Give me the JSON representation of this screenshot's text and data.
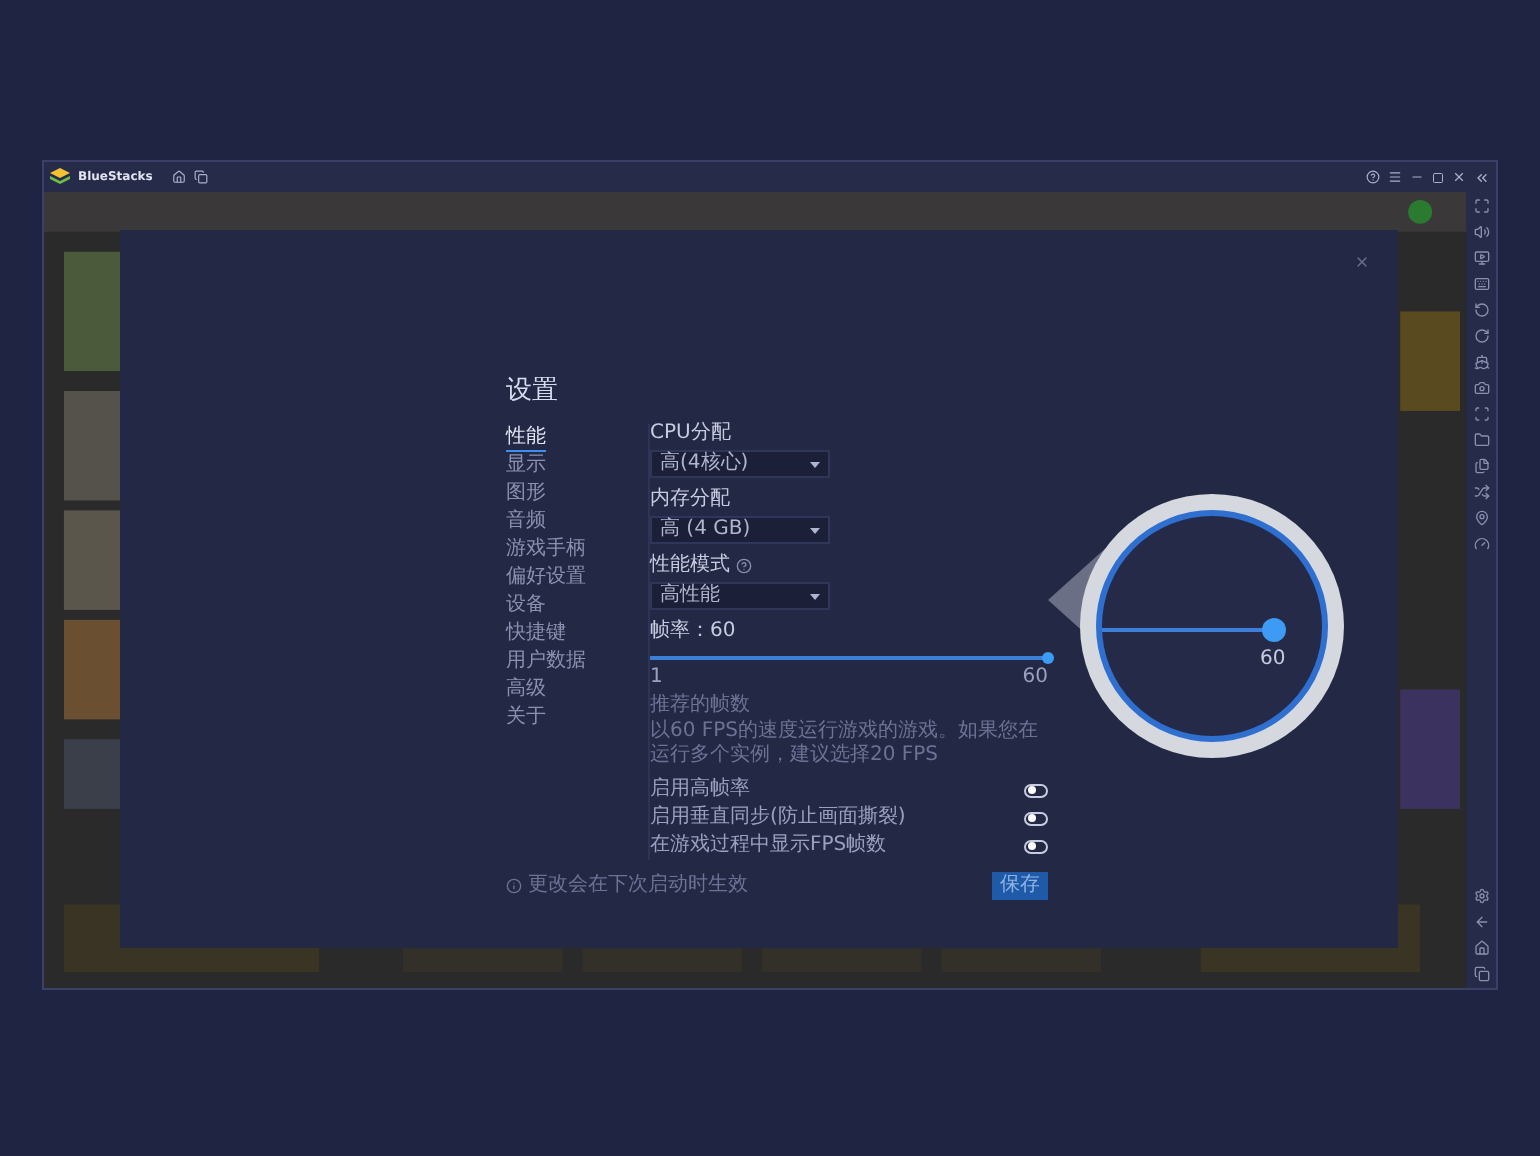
{
  "window": {
    "title": "BlueStacks"
  },
  "settings": {
    "title": "设置",
    "nav": [
      {
        "label": "性能",
        "selected": true
      },
      {
        "label": "显示",
        "selected": false
      },
      {
        "label": "图形",
        "selected": false
      },
      {
        "label": "音频",
        "selected": false
      },
      {
        "label": "游戏手柄",
        "selected": false
      },
      {
        "label": "偏好设置",
        "selected": false
      },
      {
        "label": "设备",
        "selected": false
      },
      {
        "label": "快捷键",
        "selected": false
      },
      {
        "label": "用户数据",
        "selected": false
      },
      {
        "label": "高级",
        "selected": false
      },
      {
        "label": "关于",
        "selected": false
      }
    ],
    "dropdowns": [
      {
        "label": "CPU分配",
        "value": "高(4核心)",
        "help": false
      },
      {
        "label": "内存分配",
        "value": "高 (4 GB)",
        "help": false
      },
      {
        "label": "性能模式",
        "value": "高性能",
        "help": true
      }
    ],
    "frame_rate": {
      "label": "帧率：60",
      "level": 1,
      "min": "1",
      "max": "60",
      "hint_title": "推荐的帧数",
      "hint": "以60 FPS的速度运行游戏的游戏。如果您在运行多个实例，建议选择20 FPS"
    },
    "toggles": [
      {
        "label": "启用高帧率",
        "on": false
      },
      {
        "label": "启用垂直同步(防止画面撕裂)",
        "on": false
      },
      {
        "label": "在游戏过程中显示FPS帧数",
        "on": false
      }
    ],
    "note": "更改会在下次启动时生效",
    "save": "保存"
  },
  "magnifier": {
    "reading": "60"
  }
}
